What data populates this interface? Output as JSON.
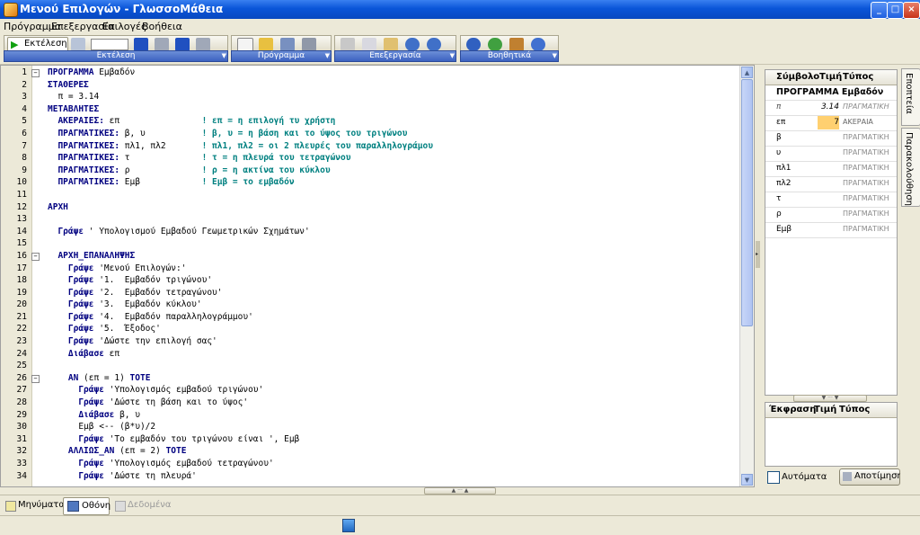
{
  "window": {
    "title": "Μενού Επιλογών - ΓλωσσοΜάθεια"
  },
  "menu": [
    "Πρόγραμμα",
    "Επεξεργασία",
    "Επιλογές",
    "Βοήθεια"
  ],
  "toolbar": {
    "run_label": "Εκτέλεση",
    "groups": [
      "Εκτέλεση",
      "Πρόγραμμα",
      "Επεξεργασία",
      "Βοηθητικά"
    ]
  },
  "code": {
    "lines": [
      {
        "n": "1",
        "segs": [
          {
            "c": "kw",
            "t": "ΠΡΟΓΡΑΜΜΑ"
          },
          {
            "c": "",
            "t": " Εμβαδόν"
          }
        ]
      },
      {
        "n": "2",
        "segs": [
          {
            "c": "kw",
            "t": "ΣΤΑΘΕΡΕΣ"
          }
        ]
      },
      {
        "n": "3",
        "segs": [
          {
            "c": "",
            "t": "  π = 3.14"
          }
        ]
      },
      {
        "n": "4",
        "segs": [
          {
            "c": "kw",
            "t": "ΜΕΤΑΒΛΗΤΕΣ"
          }
        ]
      },
      {
        "n": "5",
        "segs": [
          {
            "c": "kw",
            "t": "  ΑΚΕΡΑΙΕΣ:"
          },
          {
            "c": "",
            "t": " επ                "
          },
          {
            "c": "cm",
            "t": "! επ = η επιλογή τυ χρήστη"
          }
        ]
      },
      {
        "n": "6",
        "segs": [
          {
            "c": "kw",
            "t": "  ΠΡΑΓΜΑΤΙΚΕΣ:"
          },
          {
            "c": "",
            "t": " β, υ           "
          },
          {
            "c": "cm",
            "t": "! β, υ = η βάση και το ύψος του τριγώνου"
          }
        ]
      },
      {
        "n": "7",
        "segs": [
          {
            "c": "kw",
            "t": "  ΠΡΑΓΜΑΤΙΚΕΣ:"
          },
          {
            "c": "",
            "t": " πλ1, πλ2       "
          },
          {
            "c": "cm",
            "t": "! πλ1, πλ2 = οι 2 πλευρές του παραλληλογράμου"
          }
        ]
      },
      {
        "n": "8",
        "segs": [
          {
            "c": "kw",
            "t": "  ΠΡΑΓΜΑΤΙΚΕΣ:"
          },
          {
            "c": "",
            "t": " τ              "
          },
          {
            "c": "cm",
            "t": "! τ = η πλευρά του τετραγώνου"
          }
        ]
      },
      {
        "n": "9",
        "segs": [
          {
            "c": "kw",
            "t": "  ΠΡΑΓΜΑΤΙΚΕΣ:"
          },
          {
            "c": "",
            "t": " ρ              "
          },
          {
            "c": "cm",
            "t": "! ρ = η ακτίνα του κύκλου"
          }
        ]
      },
      {
        "n": "10",
        "segs": [
          {
            "c": "kw",
            "t": "  ΠΡΑΓΜΑΤΙΚΕΣ:"
          },
          {
            "c": "",
            "t": " Εμβ            "
          },
          {
            "c": "cm",
            "t": "! Εμβ = το εμβαδόν"
          }
        ]
      },
      {
        "n": "11",
        "segs": []
      },
      {
        "n": "12",
        "segs": [
          {
            "c": "kw",
            "t": "ΑΡΧΗ"
          }
        ]
      },
      {
        "n": "13",
        "segs": []
      },
      {
        "n": "14",
        "segs": [
          {
            "c": "kw",
            "t": "  Γράψε"
          },
          {
            "c": "str",
            "t": " ' Υπολογισμού Εμβαδού Γεωμετρικών Σχημάτων'"
          }
        ]
      },
      {
        "n": "15",
        "segs": []
      },
      {
        "n": "16",
        "segs": [
          {
            "c": "kw",
            "t": "  ΑΡΧΗ_ΕΠΑΝΑΛΗΨΗΣ"
          }
        ]
      },
      {
        "n": "17",
        "segs": [
          {
            "c": "kw",
            "t": "    Γράψε"
          },
          {
            "c": "str",
            "t": " 'Μενού Επιλογών:'"
          }
        ]
      },
      {
        "n": "18",
        "segs": [
          {
            "c": "kw",
            "t": "    Γράψε"
          },
          {
            "c": "str",
            "t": " '1.  Εμβαδόν τριγώνου'"
          }
        ]
      },
      {
        "n": "19",
        "segs": [
          {
            "c": "kw",
            "t": "    Γράψε"
          },
          {
            "c": "str",
            "t": " '2.  Εμβαδόν τετραγώνου'"
          }
        ]
      },
      {
        "n": "20",
        "segs": [
          {
            "c": "kw",
            "t": "    Γράψε"
          },
          {
            "c": "str",
            "t": " '3.  Εμβαδόν κύκλου'"
          }
        ]
      },
      {
        "n": "21",
        "segs": [
          {
            "c": "kw",
            "t": "    Γράψε"
          },
          {
            "c": "str",
            "t": " '4.  Εμβαδόν παραλληλογράμμου'"
          }
        ]
      },
      {
        "n": "22",
        "segs": [
          {
            "c": "kw",
            "t": "    Γράψε"
          },
          {
            "c": "str",
            "t": " '5.  Έξοδος'"
          }
        ]
      },
      {
        "n": "23",
        "segs": [
          {
            "c": "kw",
            "t": "    Γράψε"
          },
          {
            "c": "str",
            "t": " 'Δώστε την επιλογή σας'"
          }
        ]
      },
      {
        "n": "24",
        "segs": [
          {
            "c": "kw",
            "t": "    Διάβασε"
          },
          {
            "c": "",
            "t": " επ"
          }
        ]
      },
      {
        "n": "25",
        "segs": []
      },
      {
        "n": "26",
        "segs": [
          {
            "c": "kw",
            "t": "    ΑΝ"
          },
          {
            "c": "",
            "t": " (επ = 1) "
          },
          {
            "c": "kw",
            "t": "ΤΟΤΕ"
          }
        ]
      },
      {
        "n": "27",
        "segs": [
          {
            "c": "kw",
            "t": "      Γράψε"
          },
          {
            "c": "str",
            "t": " 'Υπολογισμός εμβαδού τριγώνου'"
          }
        ]
      },
      {
        "n": "28",
        "segs": [
          {
            "c": "kw",
            "t": "      Γράψε"
          },
          {
            "c": "str",
            "t": " 'Δώστε τη βάση και το ύψος'"
          }
        ]
      },
      {
        "n": "29",
        "segs": [
          {
            "c": "kw",
            "t": "      Διάβασε"
          },
          {
            "c": "",
            "t": " β, υ"
          }
        ]
      },
      {
        "n": "30",
        "segs": [
          {
            "c": "",
            "t": "      Εμβ <-- (β*υ)/2"
          }
        ]
      },
      {
        "n": "31",
        "segs": [
          {
            "c": "kw",
            "t": "      Γράψε"
          },
          {
            "c": "str",
            "t": " 'Το εμβαδόν του τριγώνου είναι ', Εμβ"
          }
        ]
      },
      {
        "n": "32",
        "segs": [
          {
            "c": "kw",
            "t": "    ΑΛΛΙΩΣ_ΑΝ"
          },
          {
            "c": "",
            "t": " (επ = 2) "
          },
          {
            "c": "kw",
            "t": "ΤΟΤΕ"
          }
        ]
      },
      {
        "n": "33",
        "segs": [
          {
            "c": "kw",
            "t": "      Γράψε"
          },
          {
            "c": "str",
            "t": " 'Υπολογισμός εμβαδού τετραγώνου'"
          }
        ]
      },
      {
        "n": "34",
        "segs": [
          {
            "c": "kw",
            "t": "      Γράψε"
          },
          {
            "c": "str",
            "t": " 'Δώστε τη πλευρά'"
          }
        ]
      }
    ]
  },
  "symbols": {
    "headers": [
      "Σύμβολο",
      "Τιμή",
      "Τύπος"
    ],
    "program_row": "ΠΡΟΓΡΑΜΜΑ  Εμβαδόν",
    "rows": [
      {
        "sym": "π",
        "val": "3.14",
        "type": "ΠΡΑΓΜΑΤΙΚΗ",
        "const": true
      },
      {
        "sym": "επ",
        "val": "7",
        "type": "ΑΚΕΡΑΙΑ",
        "hl": true
      },
      {
        "sym": "β",
        "val": "",
        "type": "ΠΡΑΓΜΑΤΙΚΗ"
      },
      {
        "sym": "υ",
        "val": "",
        "type": "ΠΡΑΓΜΑΤΙΚΗ"
      },
      {
        "sym": "πλ1",
        "val": "",
        "type": "ΠΡΑΓΜΑΤΙΚΗ"
      },
      {
        "sym": "πλ2",
        "val": "",
        "type": "ΠΡΑΓΜΑΤΙΚΗ"
      },
      {
        "sym": "τ",
        "val": "",
        "type": "ΠΡΑΓΜΑΤΙΚΗ"
      },
      {
        "sym": "ρ",
        "val": "",
        "type": "ΠΡΑΓΜΑΤΙΚΗ"
      },
      {
        "sym": "Εμβ",
        "val": "",
        "type": "ΠΡΑΓΜΑΤΙΚΗ"
      }
    ]
  },
  "expressions": {
    "headers": [
      "Έκφραση",
      "Τιμή",
      "Τύπος"
    ],
    "auto_label": "Αυτόματα",
    "eval_label": "Αποτίμηση"
  },
  "side_tabs": [
    "Εποπτεία",
    "Παρακολούθηση"
  ],
  "bottom_tabs": [
    "Μηνύματα",
    "Οθόνη",
    "Δεδομένα"
  ],
  "colors": {
    "keyword": "#000080",
    "comment": "#008080",
    "highlight": "#ffd070"
  }
}
